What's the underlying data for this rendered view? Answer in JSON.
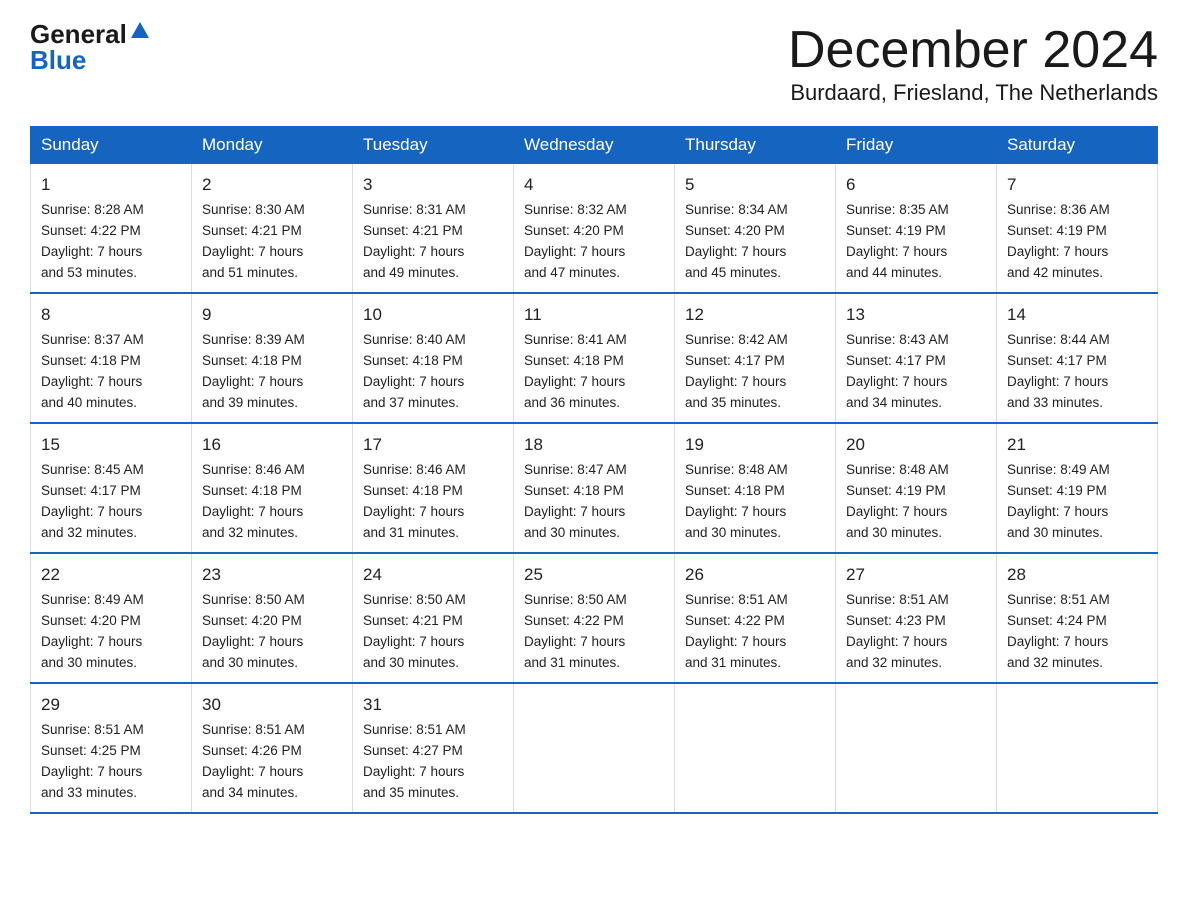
{
  "header": {
    "logo_general": "General",
    "logo_blue": "Blue",
    "month_title": "December 2024",
    "location": "Burdaard, Friesland, The Netherlands"
  },
  "days_of_week": [
    "Sunday",
    "Monday",
    "Tuesday",
    "Wednesday",
    "Thursday",
    "Friday",
    "Saturday"
  ],
  "weeks": [
    [
      {
        "day": "1",
        "sunrise": "8:28 AM",
        "sunset": "4:22 PM",
        "daylight": "7 hours and 53 minutes."
      },
      {
        "day": "2",
        "sunrise": "8:30 AM",
        "sunset": "4:21 PM",
        "daylight": "7 hours and 51 minutes."
      },
      {
        "day": "3",
        "sunrise": "8:31 AM",
        "sunset": "4:21 PM",
        "daylight": "7 hours and 49 minutes."
      },
      {
        "day": "4",
        "sunrise": "8:32 AM",
        "sunset": "4:20 PM",
        "daylight": "7 hours and 47 minutes."
      },
      {
        "day": "5",
        "sunrise": "8:34 AM",
        "sunset": "4:20 PM",
        "daylight": "7 hours and 45 minutes."
      },
      {
        "day": "6",
        "sunrise": "8:35 AM",
        "sunset": "4:19 PM",
        "daylight": "7 hours and 44 minutes."
      },
      {
        "day": "7",
        "sunrise": "8:36 AM",
        "sunset": "4:19 PM",
        "daylight": "7 hours and 42 minutes."
      }
    ],
    [
      {
        "day": "8",
        "sunrise": "8:37 AM",
        "sunset": "4:18 PM",
        "daylight": "7 hours and 40 minutes."
      },
      {
        "day": "9",
        "sunrise": "8:39 AM",
        "sunset": "4:18 PM",
        "daylight": "7 hours and 39 minutes."
      },
      {
        "day": "10",
        "sunrise": "8:40 AM",
        "sunset": "4:18 PM",
        "daylight": "7 hours and 37 minutes."
      },
      {
        "day": "11",
        "sunrise": "8:41 AM",
        "sunset": "4:18 PM",
        "daylight": "7 hours and 36 minutes."
      },
      {
        "day": "12",
        "sunrise": "8:42 AM",
        "sunset": "4:17 PM",
        "daylight": "7 hours and 35 minutes."
      },
      {
        "day": "13",
        "sunrise": "8:43 AM",
        "sunset": "4:17 PM",
        "daylight": "7 hours and 34 minutes."
      },
      {
        "day": "14",
        "sunrise": "8:44 AM",
        "sunset": "4:17 PM",
        "daylight": "7 hours and 33 minutes."
      }
    ],
    [
      {
        "day": "15",
        "sunrise": "8:45 AM",
        "sunset": "4:17 PM",
        "daylight": "7 hours and 32 minutes."
      },
      {
        "day": "16",
        "sunrise": "8:46 AM",
        "sunset": "4:18 PM",
        "daylight": "7 hours and 32 minutes."
      },
      {
        "day": "17",
        "sunrise": "8:46 AM",
        "sunset": "4:18 PM",
        "daylight": "7 hours and 31 minutes."
      },
      {
        "day": "18",
        "sunrise": "8:47 AM",
        "sunset": "4:18 PM",
        "daylight": "7 hours and 30 minutes."
      },
      {
        "day": "19",
        "sunrise": "8:48 AM",
        "sunset": "4:18 PM",
        "daylight": "7 hours and 30 minutes."
      },
      {
        "day": "20",
        "sunrise": "8:48 AM",
        "sunset": "4:19 PM",
        "daylight": "7 hours and 30 minutes."
      },
      {
        "day": "21",
        "sunrise": "8:49 AM",
        "sunset": "4:19 PM",
        "daylight": "7 hours and 30 minutes."
      }
    ],
    [
      {
        "day": "22",
        "sunrise": "8:49 AM",
        "sunset": "4:20 PM",
        "daylight": "7 hours and 30 minutes."
      },
      {
        "day": "23",
        "sunrise": "8:50 AM",
        "sunset": "4:20 PM",
        "daylight": "7 hours and 30 minutes."
      },
      {
        "day": "24",
        "sunrise": "8:50 AM",
        "sunset": "4:21 PM",
        "daylight": "7 hours and 30 minutes."
      },
      {
        "day": "25",
        "sunrise": "8:50 AM",
        "sunset": "4:22 PM",
        "daylight": "7 hours and 31 minutes."
      },
      {
        "day": "26",
        "sunrise": "8:51 AM",
        "sunset": "4:22 PM",
        "daylight": "7 hours and 31 minutes."
      },
      {
        "day": "27",
        "sunrise": "8:51 AM",
        "sunset": "4:23 PM",
        "daylight": "7 hours and 32 minutes."
      },
      {
        "day": "28",
        "sunrise": "8:51 AM",
        "sunset": "4:24 PM",
        "daylight": "7 hours and 32 minutes."
      }
    ],
    [
      {
        "day": "29",
        "sunrise": "8:51 AM",
        "sunset": "4:25 PM",
        "daylight": "7 hours and 33 minutes."
      },
      {
        "day": "30",
        "sunrise": "8:51 AM",
        "sunset": "4:26 PM",
        "daylight": "7 hours and 34 minutes."
      },
      {
        "day": "31",
        "sunrise": "8:51 AM",
        "sunset": "4:27 PM",
        "daylight": "7 hours and 35 minutes."
      },
      null,
      null,
      null,
      null
    ]
  ],
  "labels": {
    "sunrise": "Sunrise:",
    "sunset": "Sunset:",
    "daylight": "Daylight:"
  }
}
